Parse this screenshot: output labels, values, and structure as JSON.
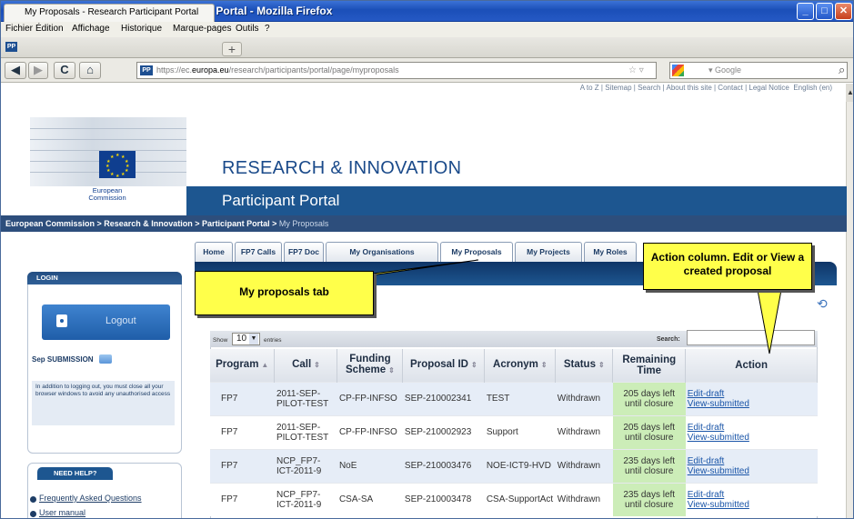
{
  "window": {
    "title": "My Proposals - Research Participant Portal - Mozilla Firefox",
    "min": "_",
    "max": "□",
    "close": "✕"
  },
  "menu": [
    "Fichier",
    "Édition",
    "Affichage",
    "Historique",
    "Marque-pages",
    "Outils",
    "?"
  ],
  "browser_tab": {
    "icon": "PP",
    "title": "My Proposals - Research Participant Portal",
    "new_tab": "+"
  },
  "nav": {
    "back": "◀",
    "forward": "▶",
    "reload": "C",
    "home": "⌂",
    "url_prefix": "https://ec.",
    "url_domain": "europa.eu",
    "url_path": "/research/participants/portal/page/myproposals",
    "star": "☆ ▿",
    "search_placeholder": "▾ Google",
    "search_go": "⌕"
  },
  "site": {
    "top_links": "A to Z | Sitemap | Search | About this site | Contact | Legal Notice",
    "language": "English (en)",
    "ec_label_1": "European",
    "ec_label_2": "Commission",
    "title": "RESEARCH & INNOVATION",
    "portal": "Participant Portal",
    "breadcrumb": "European Commission > Research & Innovation > Participant Portal > ",
    "breadcrumb_current": "My Proposals"
  },
  "tabs": [
    "Home",
    "FP7 Calls",
    "FP7 Doc",
    "My Organisations",
    "My Proposals",
    "My Projects",
    "My Roles"
  ],
  "sidebar": {
    "login_header": "LOGIN",
    "logout": "Logout",
    "sep_submission": "Sep SUBMISSION",
    "note": "In addition to logging out, you must close all your browser windows to avoid any unauthorised access",
    "help_header": "NEED HELP?",
    "help_items": [
      "Frequently Asked Questions",
      "User manual"
    ]
  },
  "table_controls": {
    "show": "Show",
    "page_size": "10",
    "entries": "entries",
    "search_label": "Search:",
    "search_value": ""
  },
  "columns": [
    "Program",
    "Call",
    "Funding Scheme",
    "Proposal ID",
    "Acronym",
    "Status",
    "Remaining Time",
    "Action"
  ],
  "rows": [
    {
      "program": "FP7",
      "call": "2011-SEP-PILOT-TEST",
      "scheme": "CP-FP-INFSO",
      "id": "SEP-210002341",
      "acronym": "TEST",
      "status": "Withdrawn",
      "remaining": "205 days left until closure",
      "action1": "Edit-draft",
      "action2": "View-submitted"
    },
    {
      "program": "FP7",
      "call": "2011-SEP-PILOT-TEST",
      "scheme": "CP-FP-INFSO",
      "id": "SEP-210002923",
      "acronym": "Support",
      "status": "Withdrawn",
      "remaining": "205 days left until closure",
      "action1": "Edit-draft",
      "action2": "View-submitted"
    },
    {
      "program": "FP7",
      "call": "NCP_FP7-ICT-2011-9",
      "scheme": "NoE",
      "id": "SEP-210003476",
      "acronym": "NOE-ICT9-HVD",
      "status": "Withdrawn",
      "remaining": "235 days left until closure",
      "action1": "Edit-draft",
      "action2": "View-submitted"
    },
    {
      "program": "FP7",
      "call": "NCP_FP7-ICT-2011-9",
      "scheme": "CSA-SA",
      "id": "SEP-210003478",
      "acronym": "CSA-SupportAct",
      "status": "Withdrawn",
      "remaining": "235 days left until closure",
      "action1": "Edit-draft",
      "action2": "View-submitted"
    }
  ],
  "callouts": {
    "proposals_tab": "My proposals tab",
    "action_column": "Action column. Edit or View a created proposal"
  },
  "colors": {
    "portal_blue": "#1d5690",
    "callout_yellow": "#ffff4a",
    "remaining_green": "#ccedb8",
    "link": "#1a55a8"
  }
}
